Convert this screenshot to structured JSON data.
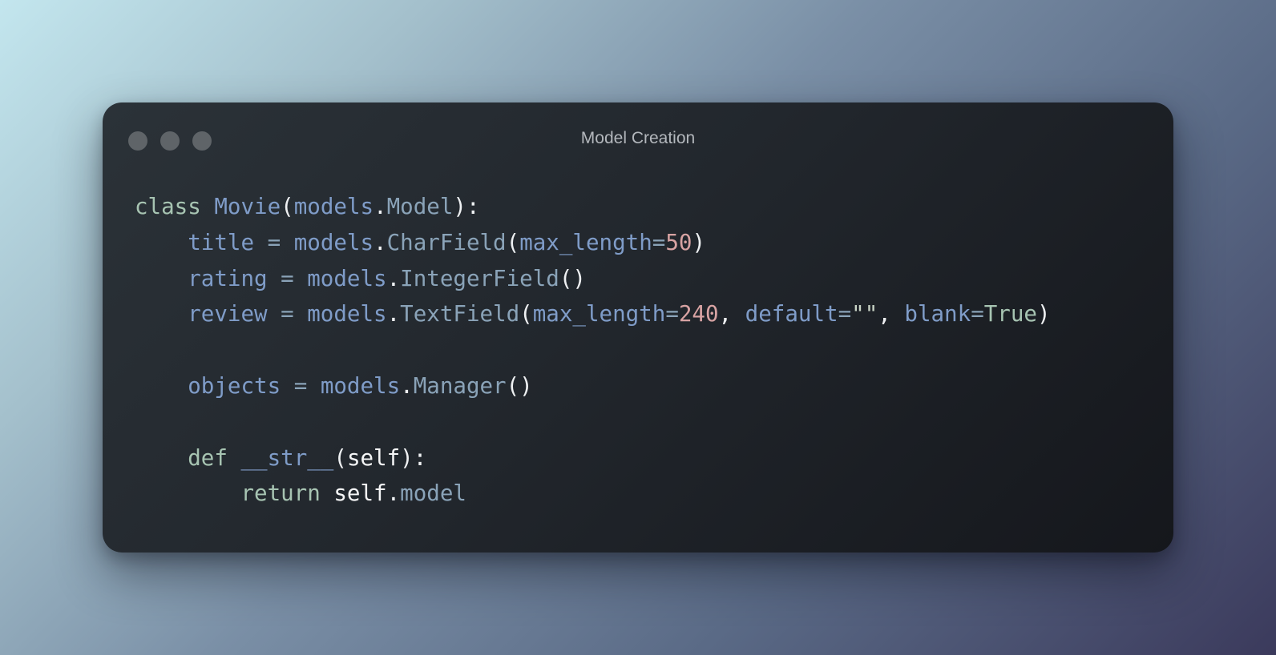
{
  "window": {
    "title": "Model Creation",
    "controls": [
      "close",
      "minimize",
      "maximize"
    ]
  },
  "code": {
    "language": "python",
    "lines": [
      [
        {
          "text": "class",
          "type": "kw"
        },
        {
          "text": " ",
          "type": "plain"
        },
        {
          "text": "Movie",
          "type": "class"
        },
        {
          "text": "(",
          "type": "punc"
        },
        {
          "text": "models",
          "type": "var"
        },
        {
          "text": ".",
          "type": "punc"
        },
        {
          "text": "Model",
          "type": "attr"
        },
        {
          "text": "):",
          "type": "punc"
        }
      ],
      [
        {
          "text": "    ",
          "type": "plain"
        },
        {
          "text": "title",
          "type": "var"
        },
        {
          "text": " = ",
          "type": "op"
        },
        {
          "text": "models",
          "type": "var"
        },
        {
          "text": ".",
          "type": "punc"
        },
        {
          "text": "CharField",
          "type": "attr"
        },
        {
          "text": "(",
          "type": "punc"
        },
        {
          "text": "max_length",
          "type": "param"
        },
        {
          "text": "=",
          "type": "op"
        },
        {
          "text": "50",
          "type": "num"
        },
        {
          "text": ")",
          "type": "punc"
        }
      ],
      [
        {
          "text": "    ",
          "type": "plain"
        },
        {
          "text": "rating",
          "type": "var"
        },
        {
          "text": " = ",
          "type": "op"
        },
        {
          "text": "models",
          "type": "var"
        },
        {
          "text": ".",
          "type": "punc"
        },
        {
          "text": "IntegerField",
          "type": "attr"
        },
        {
          "text": "()",
          "type": "punc"
        }
      ],
      [
        {
          "text": "    ",
          "type": "plain"
        },
        {
          "text": "review",
          "type": "var"
        },
        {
          "text": " = ",
          "type": "op"
        },
        {
          "text": "models",
          "type": "var"
        },
        {
          "text": ".",
          "type": "punc"
        },
        {
          "text": "TextField",
          "type": "attr"
        },
        {
          "text": "(",
          "type": "punc"
        },
        {
          "text": "max_length",
          "type": "param"
        },
        {
          "text": "=",
          "type": "op"
        },
        {
          "text": "240",
          "type": "num"
        },
        {
          "text": ", ",
          "type": "punc"
        },
        {
          "text": "default",
          "type": "param"
        },
        {
          "text": "=",
          "type": "op"
        },
        {
          "text": "\"\"",
          "type": "str"
        },
        {
          "text": ", ",
          "type": "punc"
        },
        {
          "text": "blank",
          "type": "param"
        },
        {
          "text": "=",
          "type": "op"
        },
        {
          "text": "True",
          "type": "const"
        },
        {
          "text": ")",
          "type": "punc"
        }
      ],
      [],
      [
        {
          "text": "    ",
          "type": "plain"
        },
        {
          "text": "objects",
          "type": "var"
        },
        {
          "text": " = ",
          "type": "op"
        },
        {
          "text": "models",
          "type": "var"
        },
        {
          "text": ".",
          "type": "punc"
        },
        {
          "text": "Manager",
          "type": "attr"
        },
        {
          "text": "()",
          "type": "punc"
        }
      ],
      [],
      [
        {
          "text": "    ",
          "type": "plain"
        },
        {
          "text": "def",
          "type": "kw"
        },
        {
          "text": " ",
          "type": "plain"
        },
        {
          "text": "__str__",
          "type": "dunder"
        },
        {
          "text": "(",
          "type": "punc"
        },
        {
          "text": "self",
          "type": "self"
        },
        {
          "text": "):",
          "type": "punc"
        }
      ],
      [
        {
          "text": "        ",
          "type": "plain"
        },
        {
          "text": "return",
          "type": "kw"
        },
        {
          "text": " ",
          "type": "plain"
        },
        {
          "text": "self",
          "type": "self"
        },
        {
          "text": ".",
          "type": "punc"
        },
        {
          "text": "model",
          "type": "attr"
        }
      ]
    ]
  }
}
